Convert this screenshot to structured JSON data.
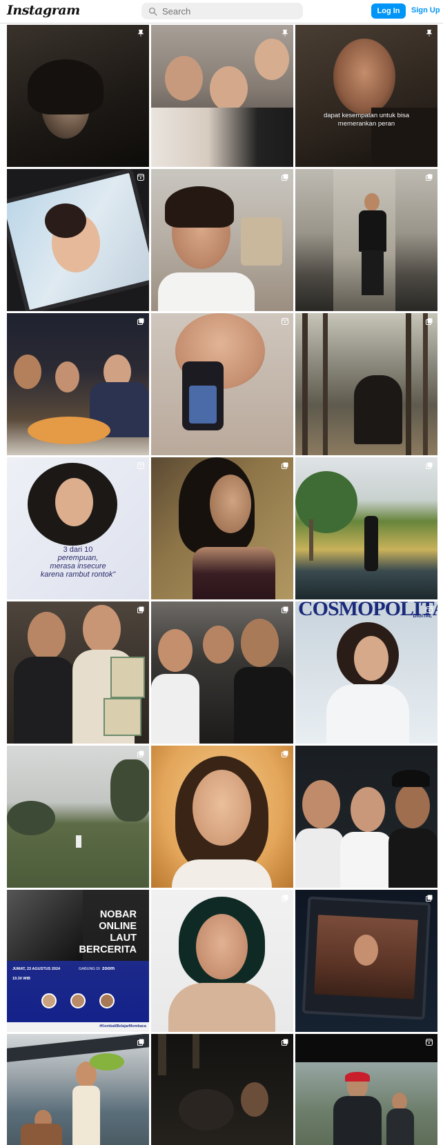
{
  "header": {
    "logo_text": "Instagram",
    "search_placeholder": "Search",
    "login_label": "Log In",
    "signup_label": "Sign Up"
  },
  "colors": {
    "accent": "#0095f6",
    "search_bg": "#efefef"
  },
  "posts": [
    {
      "badge": "pin-icon"
    },
    {
      "badge": "pin-icon"
    },
    {
      "badge": "pin-icon",
      "caption": "dapat kesempatan untuk bisa memerankan peran"
    },
    {
      "badge": "reel-icon"
    },
    {
      "badge": "carousel-icon"
    },
    {
      "badge": "carousel-icon"
    },
    {
      "badge": "carousel-icon"
    },
    {
      "badge": "reel-icon"
    },
    {
      "badge": "carousel-icon"
    },
    {
      "badge": "reel-icon",
      "caption_lines": [
        "3 dari 10",
        "perempuan,",
        "merasa insecure",
        "karena rambut rontok\""
      ]
    },
    {
      "badge": "carousel-icon"
    },
    {
      "badge": "carousel-icon"
    },
    {
      "badge": "carousel-icon"
    },
    {
      "badge": "carousel-icon"
    },
    {
      "badge": "reel-icon",
      "magazine": "COSMOPOLITAN",
      "magazine_sub": "DIGITAL"
    },
    {
      "badge": "carousel-icon"
    },
    {
      "badge": "carousel-icon"
    },
    {
      "badge": "carousel-icon"
    },
    {
      "badge": "none",
      "poster_title": [
        "NOBAR",
        "ONLINE",
        "LAUT",
        "BERCERITA"
      ],
      "poster_date": "JUMAT, 23 AGUSTUS 2024",
      "poster_time": "19.30 WIB",
      "poster_join": "GABUNG DI",
      "poster_zoom": "zoom",
      "poster_hashtag": "#KembaliBelajarMembaca"
    },
    {
      "badge": "carousel-icon"
    },
    {
      "badge": "carousel-icon"
    },
    {
      "badge": "carousel-icon"
    },
    {
      "badge": "carousel-icon"
    },
    {
      "badge": "reel-icon"
    }
  ]
}
